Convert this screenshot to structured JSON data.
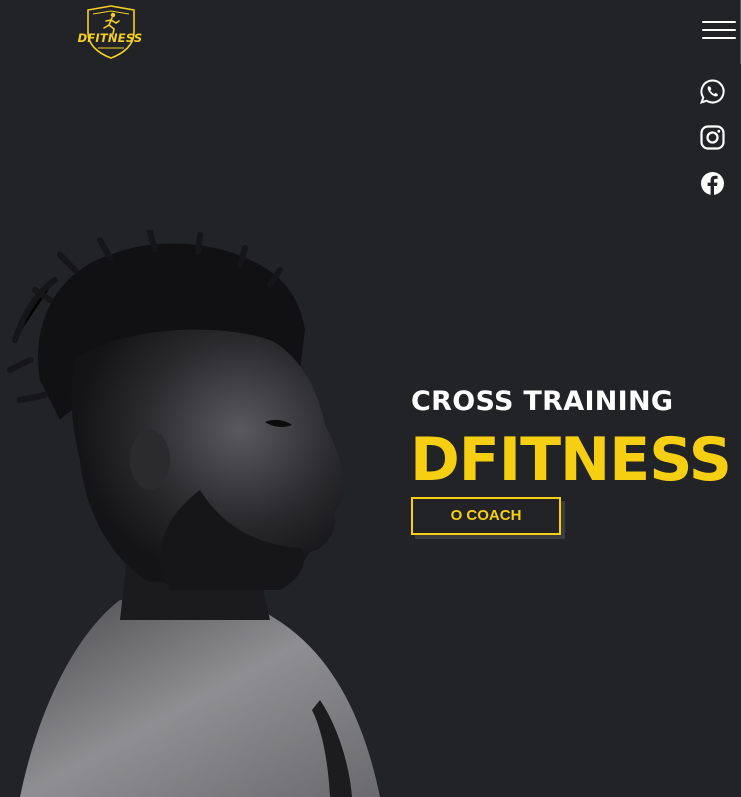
{
  "brand": {
    "logo_text": "DFITNESS",
    "accent_color": "#f7cf12",
    "background_color": "#222327"
  },
  "header": {
    "menu_icon": "hamburger-menu-icon"
  },
  "social": [
    {
      "icon": "whatsapp-icon"
    },
    {
      "icon": "instagram-icon"
    },
    {
      "icon": "facebook-icon"
    }
  ],
  "hero": {
    "subtitle": "CROSS TRAINING",
    "title": "DFITNESS",
    "cta_label": "O COACH",
    "image": "athlete-portrait"
  }
}
